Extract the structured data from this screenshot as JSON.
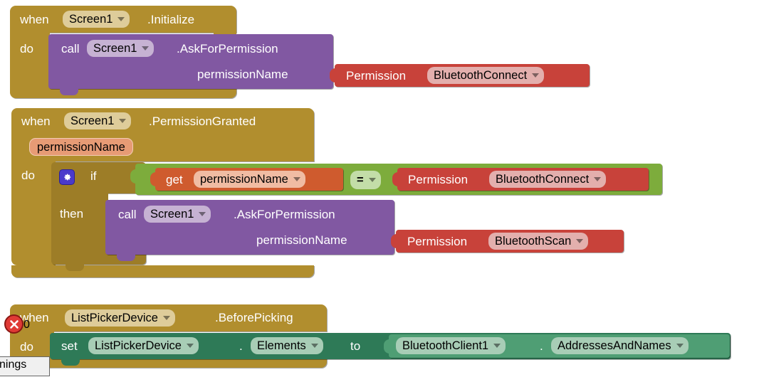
{
  "workspace": {
    "name": "blocks-canvas",
    "background": "#ffffff"
  },
  "colors": {
    "event_gold": "#B18E2E",
    "method_purple": "#8158A2",
    "helper_red": "#C8423A",
    "logic_green": "#7DAC3C",
    "variable_orange": "#CF5B2E",
    "setter_green": "#2E7A57",
    "error_red": "#E03A35",
    "mutator_blue": "#4A3ACB"
  },
  "blocks": [
    {
      "id": "block1",
      "type": "event",
      "keyword": "when",
      "component": "Screen1",
      "event": ".Initialize",
      "body_label": "do",
      "statement": {
        "type": "method-call",
        "keyword": "call",
        "component": "Screen1",
        "method": ".AskForPermission",
        "arg_label": "permissionName",
        "value": {
          "type": "helper",
          "label": "Permission",
          "selection": "BluetoothConnect"
        }
      }
    },
    {
      "id": "block2",
      "type": "event",
      "keyword": "when",
      "component": "Screen1",
      "event": ".PermissionGranted",
      "param": "permissionName",
      "body_label": "do",
      "statement": {
        "type": "control-if",
        "if_label": "if",
        "then_label": "then",
        "mutator_icon": "gear-icon",
        "condition": {
          "type": "compare",
          "left": {
            "type": "variable-get",
            "keyword": "get",
            "selection": "permissionName"
          },
          "operator": "=",
          "right": {
            "type": "helper",
            "label": "Permission",
            "selection": "BluetoothConnect"
          }
        },
        "then_statement": {
          "type": "method-call",
          "keyword": "call",
          "component": "Screen1",
          "method": ".AskForPermission",
          "arg_label": "permissionName",
          "value": {
            "type": "helper",
            "label": "Permission",
            "selection": "BluetoothScan"
          }
        }
      }
    },
    {
      "id": "block3",
      "type": "event",
      "keyword": "when",
      "component": "ListPickerDevice",
      "event": ".BeforePicking",
      "body_label": "do",
      "statement": {
        "type": "property-set",
        "keyword": "set",
        "component": "ListPickerDevice",
        "dot": ".",
        "property": "Elements",
        "to_label": "to",
        "value": {
          "type": "property-get",
          "component": "BluetoothClient1",
          "dot": ".",
          "property": "AddressesAndNames"
        }
      }
    }
  ],
  "warning_indicator": {
    "name": "warning-error-indicator",
    "error_count": "0",
    "up_arrow": "collapse-warnings-arrow",
    "down_arrow": "expand-warnings-arrow",
    "error_icon": "error-circle-icon",
    "tooltip_text": "nings"
  }
}
